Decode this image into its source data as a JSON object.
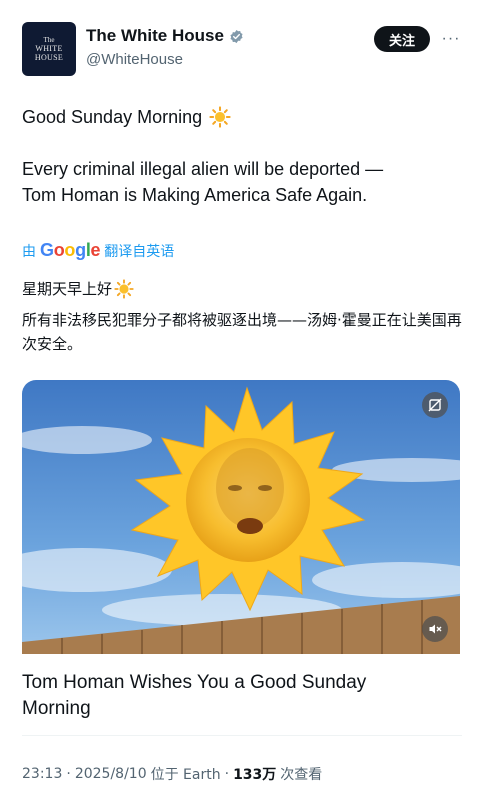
{
  "account": {
    "name": "The White House",
    "handle": "@WhiteHouse",
    "avatar_text": {
      "the": "The",
      "line1": "WHITE",
      "line2": "HOUSE"
    }
  },
  "actions": {
    "follow_label": "关注",
    "more_label": "···"
  },
  "tweet": {
    "greeting": "Good Sunday Morning",
    "line1": "Every criminal illegal alien will be deported —",
    "line2": "Tom Homan is Making America Safe Again."
  },
  "translation": {
    "by_prefix": "由",
    "google": "Google",
    "translated_from": "翻译自英语",
    "greeting": "星期天早上好",
    "body": "所有非法移民犯罪分子都将被驱逐出境——汤姆·霍曼正在让美国再次安全。"
  },
  "card": {
    "title_line1": "Tom Homan Wishes You a Good Sunday",
    "title_line2": "Morning"
  },
  "meta": {
    "time": "23:13",
    "date": "2025/8/10",
    "location": "位于 Earth",
    "views_count": "133万",
    "views_label": "次查看"
  },
  "colors": {
    "accent": "#1d9bf0",
    "text": "#0f1419",
    "secondary": "#536471",
    "sun": "#f6c218"
  },
  "icons": {
    "verified": "verified-badge-icon",
    "sun": "sun-emoji-icon",
    "sensitive": "sensitive-media-icon",
    "mute": "mute-icon"
  }
}
